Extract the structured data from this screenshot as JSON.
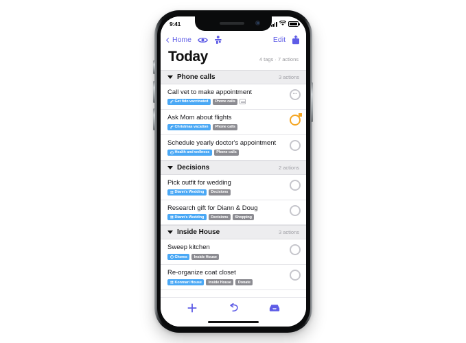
{
  "status_bar": {
    "time": "9:41",
    "signal_icon": "cellular-bars-icon",
    "wifi_icon": "wifi-icon",
    "battery_icon": "battery-full-icon"
  },
  "nav": {
    "back_label": "Home",
    "back_icon": "chevron-left-icon",
    "eye_icon": "eye-icon",
    "perspective_icon": "person-perspective-icon",
    "edit_label": "Edit",
    "share_icon": "share-export-icon"
  },
  "header": {
    "title": "Today",
    "meta": "4 tags · 7 actions"
  },
  "accent": "#5E5CE6",
  "tag_blue": "#4AA8F5",
  "tag_gray": "#8C8C92",
  "orange": "#F5A623",
  "sections": [
    {
      "title": "Phone calls",
      "count": "3 actions",
      "collapse_icon": "triangle-down-icon",
      "tasks": [
        {
          "title": "Call vet to make appointment",
          "checkbox": "dots",
          "tags": [
            {
              "label": "Get fido vaccinated",
              "style": "blue",
              "icon": "tag-leaf-icon"
            },
            {
              "label": "Phone calls",
              "style": "gray",
              "icon": ""
            }
          ],
          "note": true
        },
        {
          "title": "Ask Mom about flights",
          "checkbox": "orange",
          "tags": [
            {
              "label": "Christmas vacation",
              "style": "blue",
              "icon": "tag-leaf-icon"
            },
            {
              "label": "Phone calls",
              "style": "gray",
              "icon": ""
            }
          ],
          "note": false
        },
        {
          "title": "Schedule yearly doctor's appointment",
          "checkbox": "empty",
          "tags": [
            {
              "label": "Health and wellness",
              "style": "blue",
              "icon": "tag-target-icon"
            },
            {
              "label": "Phone calls",
              "style": "gray",
              "icon": ""
            }
          ],
          "note": false
        }
      ]
    },
    {
      "title": "Decisions",
      "count": "2 actions",
      "collapse_icon": "triangle-down-icon",
      "tasks": [
        {
          "title": "Pick outfit for wedding",
          "checkbox": "empty",
          "tags": [
            {
              "label": "Diann's Wedding",
              "style": "blue",
              "icon": "tag-grid-icon"
            },
            {
              "label": "Decisions",
              "style": "gray",
              "icon": ""
            }
          ],
          "note": false
        },
        {
          "title": "Research gift for Diann & Doug",
          "checkbox": "empty",
          "tags": [
            {
              "label": "Diann's Wedding",
              "style": "blue",
              "icon": "tag-grid-icon"
            },
            {
              "label": "Decisions",
              "style": "gray",
              "icon": ""
            },
            {
              "label": "Shopping",
              "style": "gray",
              "icon": ""
            }
          ],
          "note": false
        }
      ]
    },
    {
      "title": "Inside House",
      "count": "3 actions",
      "collapse_icon": "triangle-down-icon",
      "tasks": [
        {
          "title": "Sweep kitchen",
          "checkbox": "empty",
          "tags": [
            {
              "label": "Chores",
              "style": "blue",
              "icon": "tag-target-icon"
            },
            {
              "label": "Inside House",
              "style": "gray",
              "icon": ""
            }
          ],
          "note": false
        },
        {
          "title": "Re-organize coat closet",
          "checkbox": "empty",
          "tags": [
            {
              "label": "Konmari House",
              "style": "blue",
              "icon": "tag-grid-icon"
            },
            {
              "label": "Inside House",
              "style": "gray",
              "icon": ""
            },
            {
              "label": "Donate",
              "style": "gray",
              "icon": ""
            }
          ],
          "note": false
        }
      ]
    }
  ],
  "toolbar": {
    "add_icon": "plus-icon",
    "undo_icon": "undo-arrow-icon",
    "inbox_icon": "inbox-tray-icon"
  }
}
